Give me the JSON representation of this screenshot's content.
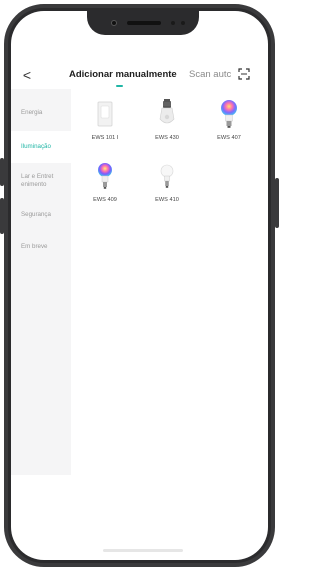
{
  "header": {
    "title": "Adicionar manualmente",
    "scan_label": "Scan autc",
    "back_glyph": "<",
    "accent_color": "#21b6a6"
  },
  "sidebar": {
    "items": [
      {
        "label": "Energia",
        "active": false
      },
      {
        "label": "Iluminação",
        "active": true
      },
      {
        "label_line1": "Lar e Entret",
        "label_line2": "enimento",
        "active": false
      },
      {
        "label": "Segurança",
        "active": false
      },
      {
        "label": "Em breve",
        "active": false
      }
    ]
  },
  "devices": [
    {
      "label": "EWS 101 I",
      "icon": "switch-icon"
    },
    {
      "label": "EWS 430",
      "icon": "socket-adapter-icon"
    },
    {
      "label": "EWS 407",
      "icon": "rgb-bulb-icon"
    },
    {
      "label": "EWS 409",
      "icon": "rgb-bulb-icon"
    },
    {
      "label": "EWS 410",
      "icon": "white-bulb-icon"
    }
  ]
}
